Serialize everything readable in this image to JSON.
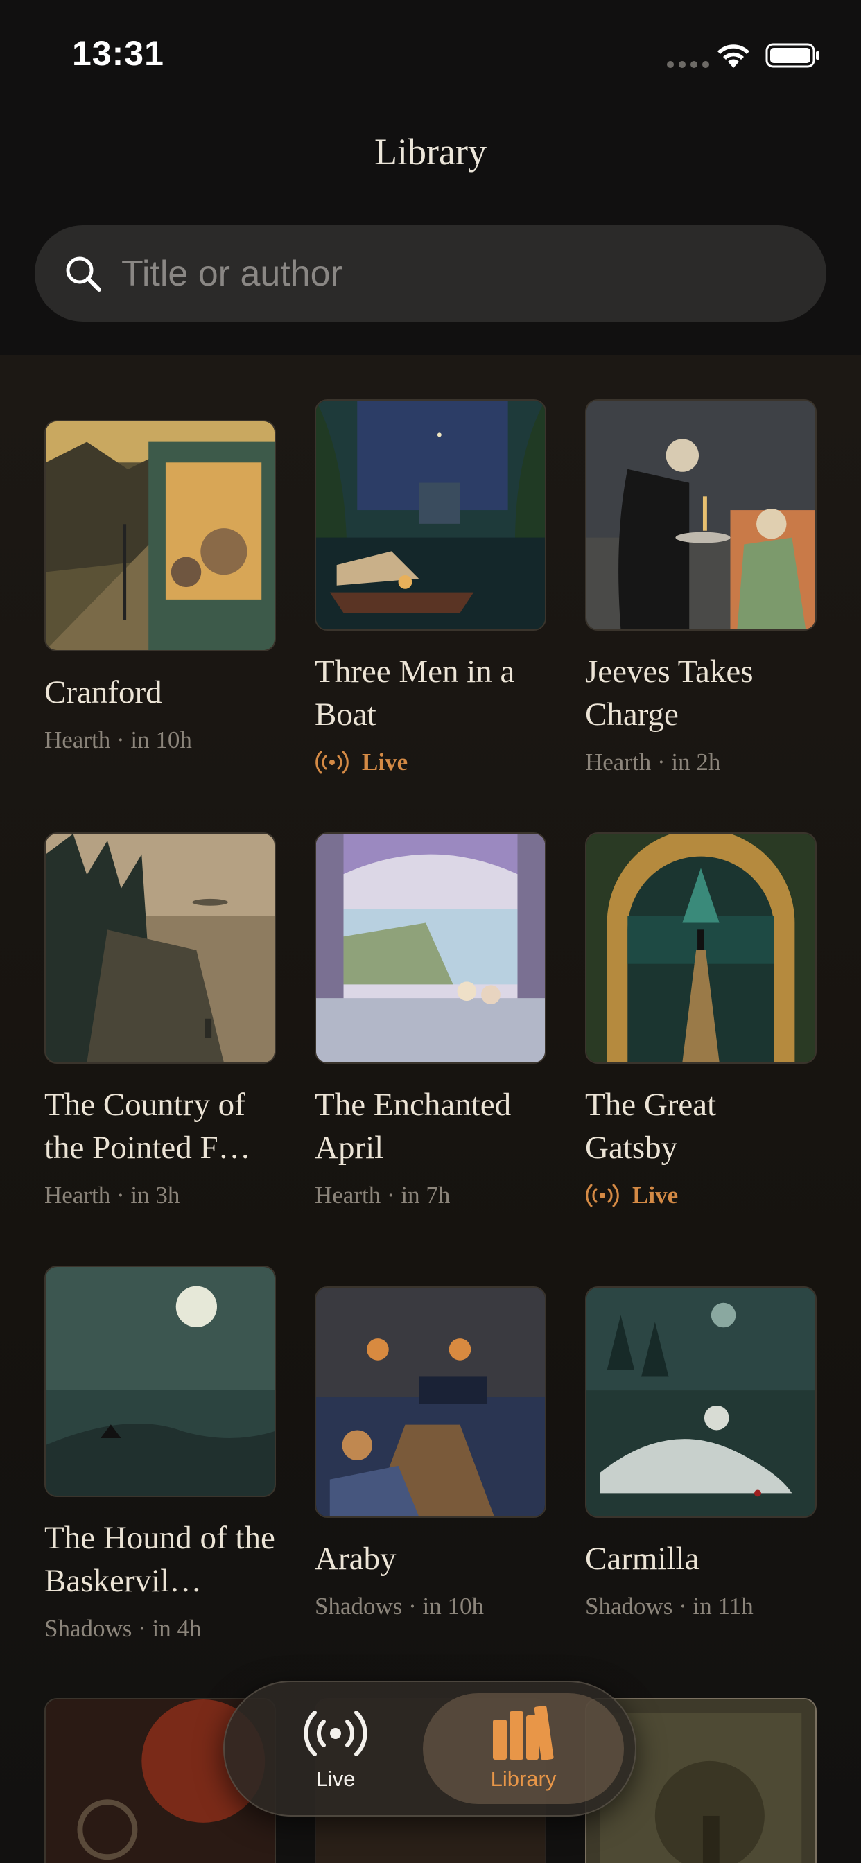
{
  "status_bar": {
    "time": "13:31"
  },
  "header": {
    "title": "Library"
  },
  "search": {
    "placeholder": "Title or author",
    "value": ""
  },
  "books": [
    {
      "title": "Cranford",
      "meta": "Hearth · in 10h",
      "live": false
    },
    {
      "title": "Three Men in a Boat",
      "meta": "Live",
      "live": true
    },
    {
      "title": "Jeeves Takes Charge",
      "meta": "Hearth · in 2h",
      "live": false
    },
    {
      "title": "The Country of the Pointed F…",
      "meta": "Hearth · in 3h",
      "live": false
    },
    {
      "title": "The Enchanted April",
      "meta": "Hearth · in 7h",
      "live": false
    },
    {
      "title": "The Great Gatsby",
      "meta": "Live",
      "live": true
    },
    {
      "title": "The Hound of the Baskervil…",
      "meta": "Shadows · in 4h",
      "live": false
    },
    {
      "title": "Araby",
      "meta": "Shadows · in 10h",
      "live": false
    },
    {
      "title": "Carmilla",
      "meta": "Shadows · in 11h",
      "live": false
    }
  ],
  "tab_bar": {
    "tabs": [
      {
        "label": "Live",
        "icon": "broadcast-icon",
        "selected": false
      },
      {
        "label": "Library",
        "icon": "books-icon",
        "selected": true
      }
    ]
  },
  "colors": {
    "accent": "#d48a45",
    "background": "#111010"
  }
}
